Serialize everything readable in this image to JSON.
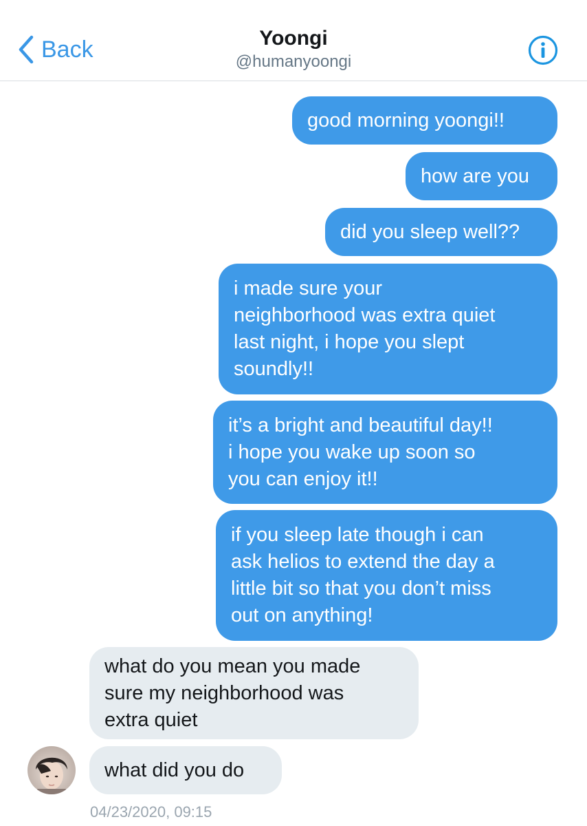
{
  "header": {
    "back_label": "Back",
    "title": "Yoongi",
    "handle": "@humanyoongi"
  },
  "messages": [
    {
      "from": "me",
      "text": "good morning yoongi!!"
    },
    {
      "from": "me",
      "text": "how are you"
    },
    {
      "from": "me",
      "text": "did you sleep well??"
    },
    {
      "from": "me",
      "lines": [
        "i made sure your",
        "neighborhood was extra quiet",
        "last night, i hope you slept",
        "soundly!!"
      ]
    },
    {
      "from": "me",
      "lines": [
        "it’s a bright and beautiful day!!",
        "i hope you wake up soon so",
        "you can enjoy it!!"
      ]
    },
    {
      "from": "me",
      "lines": [
        "if you sleep late though i can",
        "ask helios to extend the day a",
        "little bit so that you don’t miss",
        "out on anything!"
      ]
    },
    {
      "from": "them",
      "lines": [
        "what do you mean you made",
        "sure my neighborhood was",
        "extra quiet"
      ]
    },
    {
      "from": "them",
      "text": "what did you do"
    }
  ],
  "timestamp": "04/23/2020, 09:15",
  "colors": {
    "accent": "#1b95e0",
    "sent_bubble": "#3f9ae8",
    "received_bubble": "#e6ecf0"
  },
  "icons": {
    "back": "chevron-left-icon",
    "info": "info-circle-icon"
  }
}
